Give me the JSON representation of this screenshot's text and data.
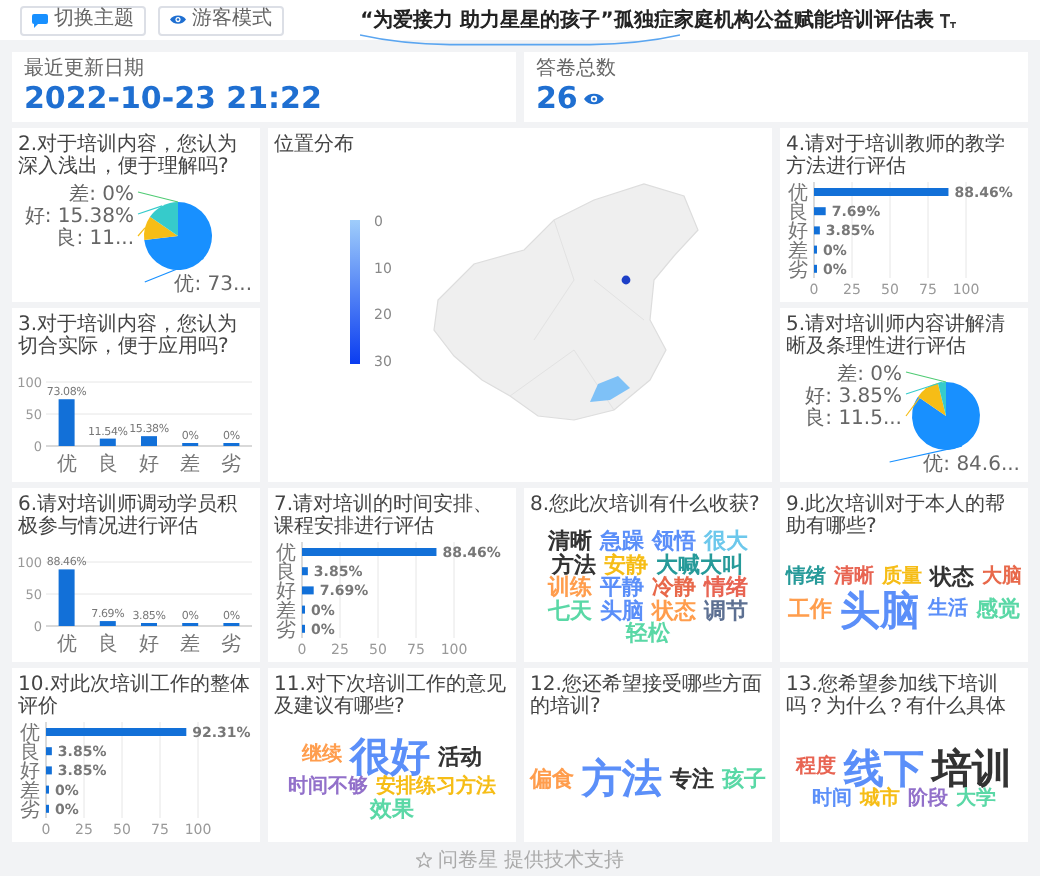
{
  "toolbar": {
    "buttons": [
      {
        "label": "切换主题",
        "kind": "theme"
      },
      {
        "label": "游客模式",
        "kind": "visitor"
      }
    ]
  },
  "title": "“为爱接力 助力星星的孩子”孤独症家庭机构公益赋能培训评估表",
  "stats": [
    {
      "label": "最近更新日期",
      "value": "2022-10-23 21:22",
      "kind": "date"
    },
    {
      "label": "答卷总数",
      "value": "26",
      "kind": "count"
    }
  ],
  "panels": [
    {
      "kind": "chart",
      "title": "2.对于培训内容，您认为深入浅出，便于理解吗?",
      "chart_data": {
        "type": "pie",
        "values": [
          73.08,
          11.54,
          15.38,
          0
        ],
        "value_labels": [
          "优: 73...",
          "良: 11...",
          "好: 15.38%",
          "差: 0%"
        ]
      }
    },
    {
      "kind": "map",
      "title": "位置分布",
      "legend_labels": [
        "0",
        "10",
        "20",
        "30"
      ]
    },
    {
      "kind": "chart",
      "title": "4.请对于培训教师的教学方法进行评估",
      "chart_data": {
        "type": "bar",
        "orientation": "horizontal",
        "grid": true,
        "categories": [
          "优",
          "良",
          "好",
          "差",
          "劣"
        ],
        "values": [
          88.46,
          7.69,
          3.85,
          0,
          0
        ],
        "xlim": [
          0,
          100
        ],
        "xticks": [
          0,
          25,
          50,
          75,
          100
        ],
        "value_labels": [
          "88.46%",
          "7.69%",
          "3.85%",
          "0%",
          "0%"
        ]
      }
    },
    {
      "kind": "chart",
      "title": "3.对于培训内容，您认为切合实际，便于应用吗?",
      "chart_data": {
        "type": "bar",
        "orientation": "vertical",
        "grid": true,
        "categories": [
          "优",
          "良",
          "好",
          "差",
          "劣"
        ],
        "values": [
          73.08,
          11.54,
          15.38,
          0,
          0
        ],
        "ylim": [
          0,
          100
        ],
        "yticks": [
          0,
          50,
          100
        ],
        "value_labels": [
          "73.08%",
          "11.54%",
          "15.38%",
          "0%",
          "0%"
        ]
      }
    },
    {
      "kind": "chart",
      "title": "5.请对培训师内容讲解清晰及条理性进行评估",
      "chart_data": {
        "type": "pie",
        "values": [
          84.62,
          11.54,
          3.85,
          0
        ],
        "value_labels": [
          "优: 84.6...",
          "良: 11.5...",
          "好: 3.85%",
          "差: 0%"
        ]
      }
    },
    {
      "kind": "chart",
      "title": "6.请对培训师调动学员积极参与情况进行评估",
      "chart_data": {
        "type": "bar",
        "orientation": "vertical",
        "grid": true,
        "categories": [
          "优",
          "良",
          "好",
          "差",
          "劣"
        ],
        "values": [
          88.46,
          7.69,
          3.85,
          0,
          0
        ],
        "ylim": [
          0,
          100
        ],
        "yticks": [
          0,
          50,
          100
        ],
        "value_labels": [
          "88.46%",
          "7.69%",
          "3.85%",
          "0%",
          "0%"
        ]
      }
    },
    {
      "kind": "chart",
      "title": "7.请对培训的时间安排、课程安排进行评估",
      "chart_data": {
        "type": "bar",
        "orientation": "horizontal",
        "grid": true,
        "categories": [
          "优",
          "良",
          "好",
          "差",
          "劣"
        ],
        "values": [
          88.46,
          3.85,
          7.69,
          0,
          0
        ],
        "xlim": [
          0,
          100
        ],
        "xticks": [
          0,
          25,
          50,
          75,
          100
        ],
        "value_labels": [
          "88.46%",
          "3.85%",
          "7.69%",
          "0%",
          "0%"
        ]
      }
    },
    {
      "kind": "cloud",
      "title": "8.您此次培训有什么收获?",
      "words": [
        {
          "text": "清晰",
          "kind": "medium",
          "color": "#333333"
        },
        {
          "text": "急躁",
          "kind": "medium",
          "color": "#5b8ff9"
        },
        {
          "text": "领悟",
          "kind": "medium",
          "color": "#5b8ff9"
        },
        {
          "text": "很大",
          "kind": "medium",
          "color": "#6dc8ec"
        },
        {
          "text": "方法",
          "kind": "medium",
          "color": "#333333"
        },
        {
          "text": "安静",
          "kind": "medium",
          "color": "#f6bd16"
        },
        {
          "text": "大喊大叫",
          "kind": "medium",
          "color": "#269a99"
        },
        {
          "text": "训练",
          "kind": "medium",
          "color": "#ff9d4d"
        },
        {
          "text": "平静",
          "kind": "medium",
          "color": "#5b8ff9"
        },
        {
          "text": "冷静",
          "kind": "medium",
          "color": "#e8684a"
        },
        {
          "text": "情绪",
          "kind": "medium",
          "color": "#e86452"
        },
        {
          "text": "七天",
          "kind": "medium",
          "color": "#5ad8a6"
        },
        {
          "text": "头脑",
          "kind": "medium",
          "color": "#5b8ff9"
        },
        {
          "text": "状态",
          "kind": "medium",
          "color": "#ff9d4d"
        },
        {
          "text": "调节",
          "kind": "medium",
          "color": "#5d7092"
        },
        {
          "text": "轻松",
          "kind": "medium",
          "color": "#5ad8a6"
        }
      ]
    },
    {
      "kind": "cloud",
      "title": "9.此次培训对于本人的帮助有哪些?",
      "words": [
        {
          "text": "情绪",
          "kind": "small",
          "color": "#269a99"
        },
        {
          "text": "清晰",
          "kind": "small",
          "color": "#e86452"
        },
        {
          "text": "质量",
          "kind": "small",
          "color": "#f6bd16"
        },
        {
          "text": "状态",
          "kind": "medium",
          "color": "#333333"
        },
        {
          "text": "大脑",
          "kind": "small",
          "color": "#e8684a"
        },
        {
          "text": "工作",
          "kind": "medium",
          "color": "#ff9d4d"
        },
        {
          "text": "头脑",
          "kind": "large",
          "color": "#5b8ff9"
        },
        {
          "text": "生活",
          "kind": "small",
          "color": "#5b8ff9"
        },
        {
          "text": "感觉",
          "kind": "medium",
          "color": "#5ad8a6"
        }
      ]
    },
    {
      "kind": "chart",
      "title": "10.对此次培训工作的整体评价",
      "chart_data": {
        "type": "bar",
        "orientation": "horizontal",
        "grid": true,
        "categories": [
          "优",
          "良",
          "好",
          "差",
          "劣"
        ],
        "values": [
          92.31,
          3.85,
          3.85,
          0,
          0
        ],
        "xlim": [
          0,
          100
        ],
        "xticks": [
          0,
          25,
          50,
          75,
          100
        ],
        "value_labels": [
          "92.31%",
          "3.85%",
          "3.85%",
          "0%",
          "0%"
        ]
      }
    },
    {
      "kind": "cloud",
      "title": "11.对下次培训工作的意见及建议有哪些?",
      "words": [
        {
          "text": "继续",
          "kind": "small",
          "color": "#ff9d4d"
        },
        {
          "text": "很好",
          "kind": "large",
          "color": "#5b8ff9"
        },
        {
          "text": "活动",
          "kind": "medium",
          "color": "#333333"
        },
        {
          "text": "时间不够",
          "kind": "small",
          "color": "#9270ca"
        },
        {
          "text": "安排练习方法",
          "kind": "small",
          "color": "#f6bd16"
        },
        {
          "text": "效果",
          "kind": "medium",
          "color": "#5ad8a6"
        }
      ]
    },
    {
      "kind": "cloud",
      "title": "12.您还希望接受哪些方面的培训?",
      "words": [
        {
          "text": "偏食",
          "kind": "medium",
          "color": "#ff9d4d"
        },
        {
          "text": "方法",
          "kind": "large",
          "color": "#5b8ff9"
        },
        {
          "text": "专注",
          "kind": "medium",
          "color": "#333333"
        },
        {
          "text": "孩子",
          "kind": "medium",
          "color": "#5ad8a6"
        }
      ]
    },
    {
      "kind": "cloud",
      "title": "13.您希望参加线下培训吗？为什么？有什么具体",
      "words": [
        {
          "text": "程度",
          "kind": "small",
          "color": "#e86452"
        },
        {
          "text": "线下",
          "kind": "large",
          "color": "#5b8ff9"
        },
        {
          "text": "培训",
          "kind": "large",
          "color": "#333333"
        },
        {
          "text": "时间",
          "kind": "small",
          "color": "#5b8ff9"
        },
        {
          "text": "城市",
          "kind": "small",
          "color": "#f6bd16"
        },
        {
          "text": "阶段",
          "kind": "small",
          "color": "#9270ca"
        },
        {
          "text": "大学",
          "kind": "small",
          "color": "#5ad8a6"
        }
      ]
    }
  ],
  "footer": "问卷星 提供技术支持"
}
